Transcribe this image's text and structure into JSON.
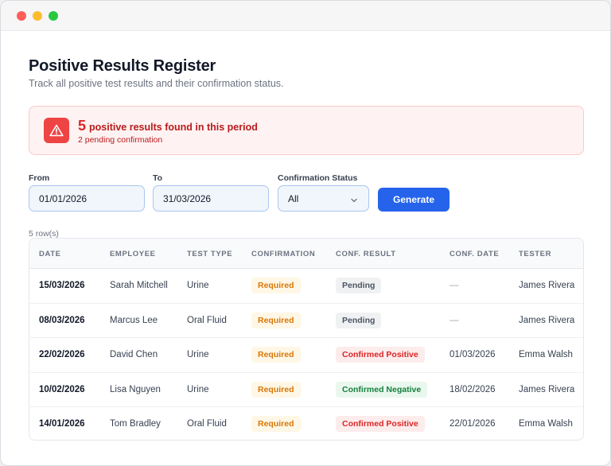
{
  "page": {
    "title": "Positive Results Register",
    "subtitle": "Track all positive test results and their confirmation status."
  },
  "alert": {
    "count": "5",
    "message": "positive results found in this period",
    "sub": "2 pending confirmation",
    "icon": "warning-triangle-icon",
    "color": "#ef4444"
  },
  "filters": {
    "from_label": "From",
    "from_value": "01/01/2026",
    "to_label": "To",
    "to_value": "31/03/2026",
    "status_label": "Confirmation Status",
    "status_value": "All",
    "generate_label": "Generate"
  },
  "table": {
    "row_count": "5 row(s)",
    "headers": [
      "Date",
      "Employee",
      "Test Type",
      "Confirmation",
      "Conf. Result",
      "Conf. Date",
      "Tester"
    ],
    "rows": [
      {
        "date": "15/03/2026",
        "employee": "Sarah Mitchell",
        "test_type": "Urine",
        "confirmation": "Required",
        "conf_result": "Pending",
        "conf_date": "—",
        "tester": "James Rivera"
      },
      {
        "date": "08/03/2026",
        "employee": "Marcus Lee",
        "test_type": "Oral Fluid",
        "confirmation": "Required",
        "conf_result": "Pending",
        "conf_date": "—",
        "tester": "James Rivera"
      },
      {
        "date": "22/02/2026",
        "employee": "David Chen",
        "test_type": "Urine",
        "confirmation": "Required",
        "conf_result": "Confirmed Positive",
        "conf_date": "01/03/2026",
        "tester": "Emma Walsh"
      },
      {
        "date": "10/02/2026",
        "employee": "Lisa Nguyen",
        "test_type": "Urine",
        "confirmation": "Required",
        "conf_result": "Confirmed Negative",
        "conf_date": "18/02/2026",
        "tester": "James Rivera"
      },
      {
        "date": "14/01/2026",
        "employee": "Tom Bradley",
        "test_type": "Oral Fluid",
        "confirmation": "Required",
        "conf_result": "Confirmed Positive",
        "conf_date": "22/01/2026",
        "tester": "Emma Walsh"
      }
    ]
  },
  "colors": {
    "accent": "#2563eb",
    "required": "#d97706",
    "positive": "#dc2626",
    "negative": "#15803d"
  }
}
